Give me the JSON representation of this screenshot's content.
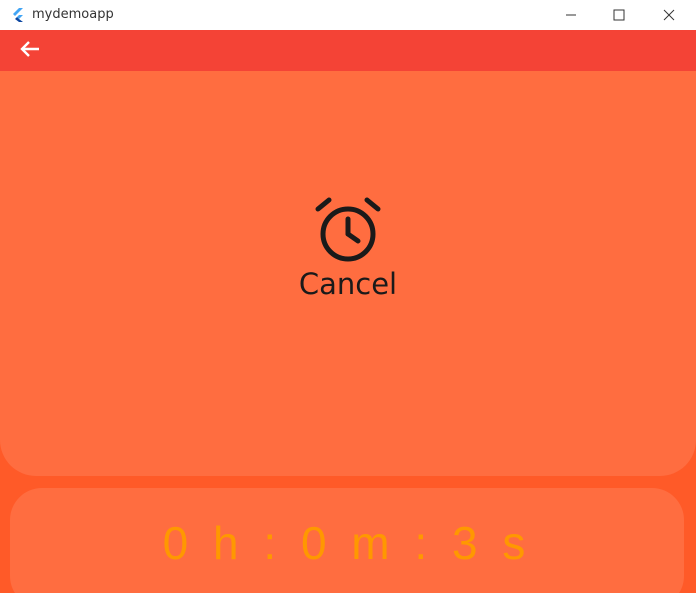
{
  "window": {
    "title": "mydemoapp",
    "controls": [
      "minimize-icon",
      "maximize-icon",
      "close-icon"
    ]
  },
  "appbar": {
    "back_icon": "arrow-back-icon",
    "color": "#f44336"
  },
  "alarm": {
    "icon": "alarm-clock-icon",
    "label": "Cancel"
  },
  "timer": {
    "text": "0 h : 0 m : 3 s",
    "color": "#ff9800"
  },
  "colors": {
    "background": "#ff5a28",
    "card": "#ff6d40"
  }
}
